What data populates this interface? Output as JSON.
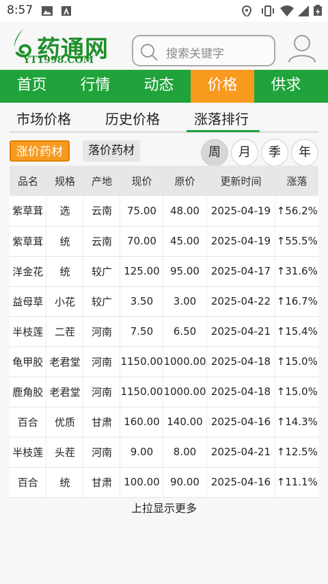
{
  "status_bar": {
    "time": "8:57"
  },
  "header": {
    "logo_text": "药通网",
    "logo_sub": "YT1998.COM",
    "search_placeholder": "搜索关键字"
  },
  "main_nav": [
    "首页",
    "行情",
    "动态",
    "价格",
    "供求"
  ],
  "main_nav_active": "价格",
  "sub_tabs": [
    "市场价格",
    "历史价格",
    "涨落排行"
  ],
  "sub_tab_active": "涨落排行",
  "filters": {
    "rise": "涨价药材",
    "fall": "落价药材"
  },
  "periods": [
    "周",
    "月",
    "季",
    "年"
  ],
  "period_active": "周",
  "table": {
    "headers": [
      "品名",
      "规格",
      "产地",
      "现价",
      "原价",
      "更新时间",
      "涨落"
    ],
    "rows": [
      [
        "紫草茸",
        "选",
        "云南",
        "75.00",
        "48.00",
        "2025-04-19",
        "↑56.2%"
      ],
      [
        "紫草茸",
        "统",
        "云南",
        "70.00",
        "45.00",
        "2025-04-19",
        "↑55.5%"
      ],
      [
        "洋金花",
        "统",
        "较广",
        "125.00",
        "95.00",
        "2025-04-17",
        "↑31.6%"
      ],
      [
        "益母草",
        "小花",
        "较广",
        "3.50",
        "3.00",
        "2025-04-22",
        "↑16.7%"
      ],
      [
        "半枝莲",
        "二茬",
        "河南",
        "7.50",
        "6.50",
        "2025-04-21",
        "↑15.4%"
      ],
      [
        "龟甲胶",
        "老君堂",
        "河南",
        "1150.00",
        "1000.00",
        "2025-04-18",
        "↑15.0%"
      ],
      [
        "鹿角胶",
        "老君堂",
        "河南",
        "1150.00",
        "1000.00",
        "2025-04-18",
        "↑15.0%"
      ],
      [
        "百合",
        "优质",
        "甘肃",
        "160.00",
        "140.00",
        "2025-04-16",
        "↑14.3%"
      ],
      [
        "半枝莲",
        "头茬",
        "河南",
        "9.00",
        "8.00",
        "2025-04-21",
        "↑12.5%"
      ],
      [
        "百合",
        "统",
        "甘肃",
        "100.00",
        "90.00",
        "2025-04-16",
        "↑11.1%"
      ]
    ]
  },
  "load_more": "上拉显示更多",
  "colors": {
    "green": "#1fa33a",
    "orange": "#f79a1e",
    "logo_green": "#1e8f2a"
  }
}
